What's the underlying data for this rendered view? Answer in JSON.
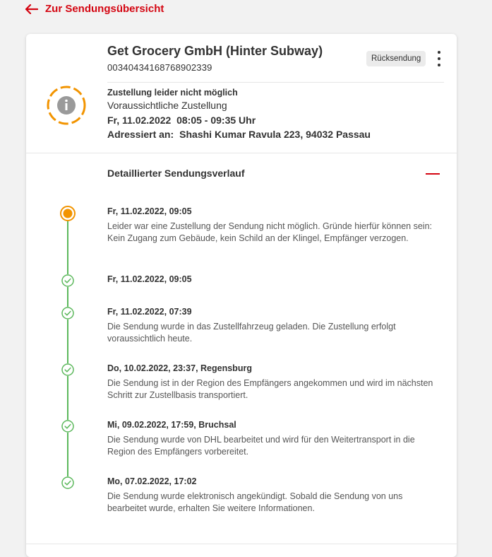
{
  "back_link": "Zur Sendungsübersicht",
  "shipment": {
    "sender": "Get Grocery GmbH (Hinter Subway)",
    "tracking_number": "00340434168768902339",
    "return_label": "Rücksendung"
  },
  "status": {
    "headline": "Zustellung leider nicht möglich",
    "expected_label": "Voraussichtliche Zustellung",
    "expected_window": "Fr, 11.02.2022  08:05 - 09:35 Uhr",
    "addressed_label": "Adressiert an:",
    "addressed_to": "Shashi Kumar Ravula 223, 94032 Passau"
  },
  "history": {
    "title": "Detaillierter Sendungsverlauf",
    "events": [
      {
        "date": "Fr, 11.02.2022, 09:05",
        "description": "Leider war eine Zustellung der Sendung nicht möglich. Gründe hierfür können sein: Kein Zugang zum Gebäude, kein Schild an der Klingel, Empfänger verzogen."
      },
      {
        "date": "Fr, 11.02.2022, 09:05",
        "description": ""
      },
      {
        "date": "Fr, 11.02.2022, 07:39",
        "description": "Die Sendung wurde in das Zustellfahrzeug geladen. Die Zustellung erfolgt voraussichtlich heute."
      },
      {
        "date": "Do, 10.02.2022, 23:37, Regensburg",
        "description": "Die Sendung ist in der Region des Empfängers angekommen und wird im nächsten Schritt zur Zustellbasis transportiert."
      },
      {
        "date": "Mi, 09.02.2022, 17:59, Bruchsal",
        "description": "Die Sendung wurde von DHL bearbeitet und wird für den Weitertransport in die Region des Empfängers vorbereitet."
      },
      {
        "date": "Mo, 07.02.2022, 17:02",
        "description": "Die Sendung wurde elektronisch angekündigt. Sobald die Sendung von uns bearbeitet wurde, erhalten Sie weitere Informationen."
      }
    ]
  },
  "icons": {
    "back": "arrow-left-icon",
    "status": "info-icon",
    "more": "more-vertical-icon",
    "collapse": "minus-icon",
    "current": "current-step-icon",
    "done": "check-circle-icon"
  },
  "colors": {
    "accent": "#d40511",
    "warning": "#f29400",
    "success": "#5cb85c",
    "text": "#323232"
  }
}
